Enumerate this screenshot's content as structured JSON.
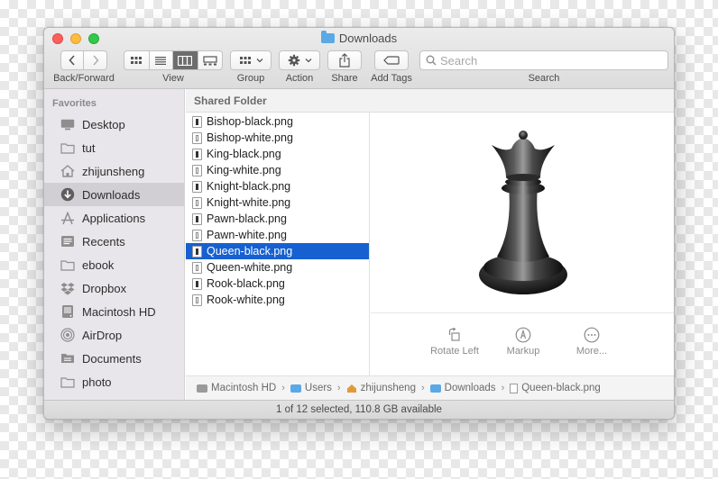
{
  "window": {
    "title": "Downloads"
  },
  "toolbar": {
    "back_forward_label": "Back/Forward",
    "view_label": "View",
    "group_label": "Group",
    "action_label": "Action",
    "share_label": "Share",
    "add_tags_label": "Add Tags",
    "search_label": "Search",
    "search_placeholder": "Search"
  },
  "sidebar": {
    "header": "Favorites",
    "items": [
      {
        "label": "Desktop",
        "icon": "desktop-icon"
      },
      {
        "label": "tut",
        "icon": "folder-icon"
      },
      {
        "label": "zhijunsheng",
        "icon": "home-icon"
      },
      {
        "label": "Downloads",
        "icon": "downloads-icon",
        "active": true
      },
      {
        "label": "Applications",
        "icon": "applications-icon"
      },
      {
        "label": "Recents",
        "icon": "recents-icon"
      },
      {
        "label": "ebook",
        "icon": "folder-icon"
      },
      {
        "label": "Dropbox",
        "icon": "dropbox-icon"
      },
      {
        "label": "Macintosh HD",
        "icon": "hard-drive-icon"
      },
      {
        "label": "AirDrop",
        "icon": "airdrop-icon"
      },
      {
        "label": "Documents",
        "icon": "documents-icon"
      },
      {
        "label": "photo",
        "icon": "folder-icon"
      }
    ]
  },
  "column": {
    "header": "Shared Folder",
    "files": [
      {
        "name": "Bishop-black.png",
        "color": "black"
      },
      {
        "name": "Bishop-white.png",
        "color": "white"
      },
      {
        "name": "King-black.png",
        "color": "black"
      },
      {
        "name": "King-white.png",
        "color": "white"
      },
      {
        "name": "Knight-black.png",
        "color": "black"
      },
      {
        "name": "Knight-white.png",
        "color": "white"
      },
      {
        "name": "Pawn-black.png",
        "color": "black"
      },
      {
        "name": "Pawn-white.png",
        "color": "white"
      },
      {
        "name": "Queen-black.png",
        "color": "black",
        "selected": true
      },
      {
        "name": "Queen-white.png",
        "color": "white"
      },
      {
        "name": "Rook-black.png",
        "color": "black"
      },
      {
        "name": "Rook-white.png",
        "color": "white"
      }
    ]
  },
  "preview": {
    "actions": [
      {
        "label": "Rotate Left",
        "icon": "rotate-left-icon"
      },
      {
        "label": "Markup",
        "icon": "markup-icon"
      },
      {
        "label": "More...",
        "icon": "more-icon"
      }
    ]
  },
  "pathbar": {
    "items": [
      "Macintosh HD",
      "Users",
      "zhijunsheng",
      "Downloads",
      "Queen-black.png"
    ]
  },
  "status": {
    "text": "1 of 12 selected, 110.8 GB available"
  },
  "colors": {
    "selection": "#1660d1",
    "folder": "#5aa9e6",
    "sidebar_bg": "#e8e6ea"
  }
}
